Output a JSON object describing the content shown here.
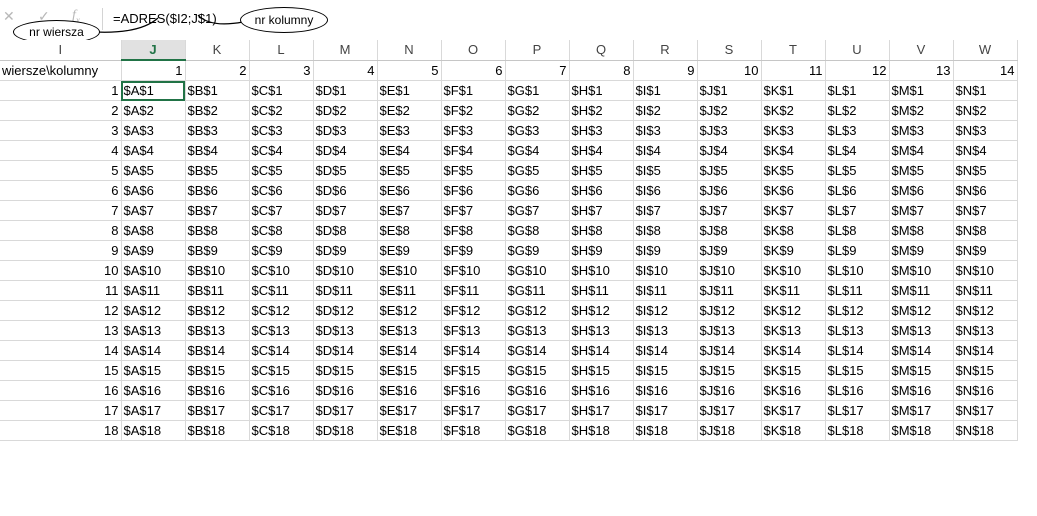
{
  "formula_bar": {
    "cancel_icon": "close-icon",
    "enter_icon": "check-icon",
    "function_icon": "function-icon",
    "formula": "=ADRES($I2;J$1)"
  },
  "callouts": {
    "row_label": "nr wiersza",
    "column_label": "nr kolumny"
  },
  "grid": {
    "column_headers": [
      "I",
      "J",
      "K",
      "L",
      "M",
      "N",
      "O",
      "P",
      "Q",
      "R",
      "S",
      "T",
      "U",
      "V",
      "W"
    ],
    "selected_column": "J",
    "corner_label": "wiersze\\kolumny",
    "column_numbers": [
      "1",
      "2",
      "3",
      "4",
      "5",
      "6",
      "7",
      "8",
      "9",
      "10",
      "11",
      "12",
      "13",
      "14"
    ],
    "row_numbers": [
      "1",
      "2",
      "3",
      "4",
      "5",
      "6",
      "7",
      "8",
      "9",
      "10",
      "11",
      "12",
      "13",
      "14",
      "15",
      "16",
      "17",
      "18"
    ],
    "rows": [
      [
        "$A$1",
        "$B$1",
        "$C$1",
        "$D$1",
        "$E$1",
        "$F$1",
        "$G$1",
        "$H$1",
        "$I$1",
        "$J$1",
        "$K$1",
        "$L$1",
        "$M$1",
        "$N$1"
      ],
      [
        "$A$2",
        "$B$2",
        "$C$2",
        "$D$2",
        "$E$2",
        "$F$2",
        "$G$2",
        "$H$2",
        "$I$2",
        "$J$2",
        "$K$2",
        "$L$2",
        "$M$2",
        "$N$2"
      ],
      [
        "$A$3",
        "$B$3",
        "$C$3",
        "$D$3",
        "$E$3",
        "$F$3",
        "$G$3",
        "$H$3",
        "$I$3",
        "$J$3",
        "$K$3",
        "$L$3",
        "$M$3",
        "$N$3"
      ],
      [
        "$A$4",
        "$B$4",
        "$C$4",
        "$D$4",
        "$E$4",
        "$F$4",
        "$G$4",
        "$H$4",
        "$I$4",
        "$J$4",
        "$K$4",
        "$L$4",
        "$M$4",
        "$N$4"
      ],
      [
        "$A$5",
        "$B$5",
        "$C$5",
        "$D$5",
        "$E$5",
        "$F$5",
        "$G$5",
        "$H$5",
        "$I$5",
        "$J$5",
        "$K$5",
        "$L$5",
        "$M$5",
        "$N$5"
      ],
      [
        "$A$6",
        "$B$6",
        "$C$6",
        "$D$6",
        "$E$6",
        "$F$6",
        "$G$6",
        "$H$6",
        "$I$6",
        "$J$6",
        "$K$6",
        "$L$6",
        "$M$6",
        "$N$6"
      ],
      [
        "$A$7",
        "$B$7",
        "$C$7",
        "$D$7",
        "$E$7",
        "$F$7",
        "$G$7",
        "$H$7",
        "$I$7",
        "$J$7",
        "$K$7",
        "$L$7",
        "$M$7",
        "$N$7"
      ],
      [
        "$A$8",
        "$B$8",
        "$C$8",
        "$D$8",
        "$E$8",
        "$F$8",
        "$G$8",
        "$H$8",
        "$I$8",
        "$J$8",
        "$K$8",
        "$L$8",
        "$M$8",
        "$N$8"
      ],
      [
        "$A$9",
        "$B$9",
        "$C$9",
        "$D$9",
        "$E$9",
        "$F$9",
        "$G$9",
        "$H$9",
        "$I$9",
        "$J$9",
        "$K$9",
        "$L$9",
        "$M$9",
        "$N$9"
      ],
      [
        "$A$10",
        "$B$10",
        "$C$10",
        "$D$10",
        "$E$10",
        "$F$10",
        "$G$10",
        "$H$10",
        "$I$10",
        "$J$10",
        "$K$10",
        "$L$10",
        "$M$10",
        "$N$10"
      ],
      [
        "$A$11",
        "$B$11",
        "$C$11",
        "$D$11",
        "$E$11",
        "$F$11",
        "$G$11",
        "$H$11",
        "$I$11",
        "$J$11",
        "$K$11",
        "$L$11",
        "$M$11",
        "$N$11"
      ],
      [
        "$A$12",
        "$B$12",
        "$C$12",
        "$D$12",
        "$E$12",
        "$F$12",
        "$G$12",
        "$H$12",
        "$I$12",
        "$J$12",
        "$K$12",
        "$L$12",
        "$M$12",
        "$N$12"
      ],
      [
        "$A$13",
        "$B$13",
        "$C$13",
        "$D$13",
        "$E$13",
        "$F$13",
        "$G$13",
        "$H$13",
        "$I$13",
        "$J$13",
        "$K$13",
        "$L$13",
        "$M$13",
        "$N$13"
      ],
      [
        "$A$14",
        "$B$14",
        "$C$14",
        "$D$14",
        "$E$14",
        "$F$14",
        "$G$14",
        "$H$14",
        "$I$14",
        "$J$14",
        "$K$14",
        "$L$14",
        "$M$14",
        "$N$14"
      ],
      [
        "$A$15",
        "$B$15",
        "$C$15",
        "$D$15",
        "$E$15",
        "$F$15",
        "$G$15",
        "$H$15",
        "$I$15",
        "$J$15",
        "$K$15",
        "$L$15",
        "$M$15",
        "$N$15"
      ],
      [
        "$A$16",
        "$B$16",
        "$C$16",
        "$D$16",
        "$E$16",
        "$F$16",
        "$G$16",
        "$H$16",
        "$I$16",
        "$J$16",
        "$K$16",
        "$L$16",
        "$M$16",
        "$N$16"
      ],
      [
        "$A$17",
        "$B$17",
        "$C$17",
        "$D$17",
        "$E$17",
        "$F$17",
        "$G$17",
        "$H$17",
        "$I$17",
        "$J$17",
        "$K$17",
        "$L$17",
        "$M$17",
        "$N$17"
      ],
      [
        "$A$18",
        "$B$18",
        "$C$18",
        "$D$18",
        "$E$18",
        "$F$18",
        "$G$18",
        "$H$18",
        "$I$18",
        "$J$18",
        "$K$18",
        "$L$18",
        "$M$18",
        "$N$18"
      ]
    ]
  },
  "colors": {
    "accent": "#217346",
    "selected_header_bg": "#e1e1e1",
    "gridline": "#d9d9d9"
  }
}
